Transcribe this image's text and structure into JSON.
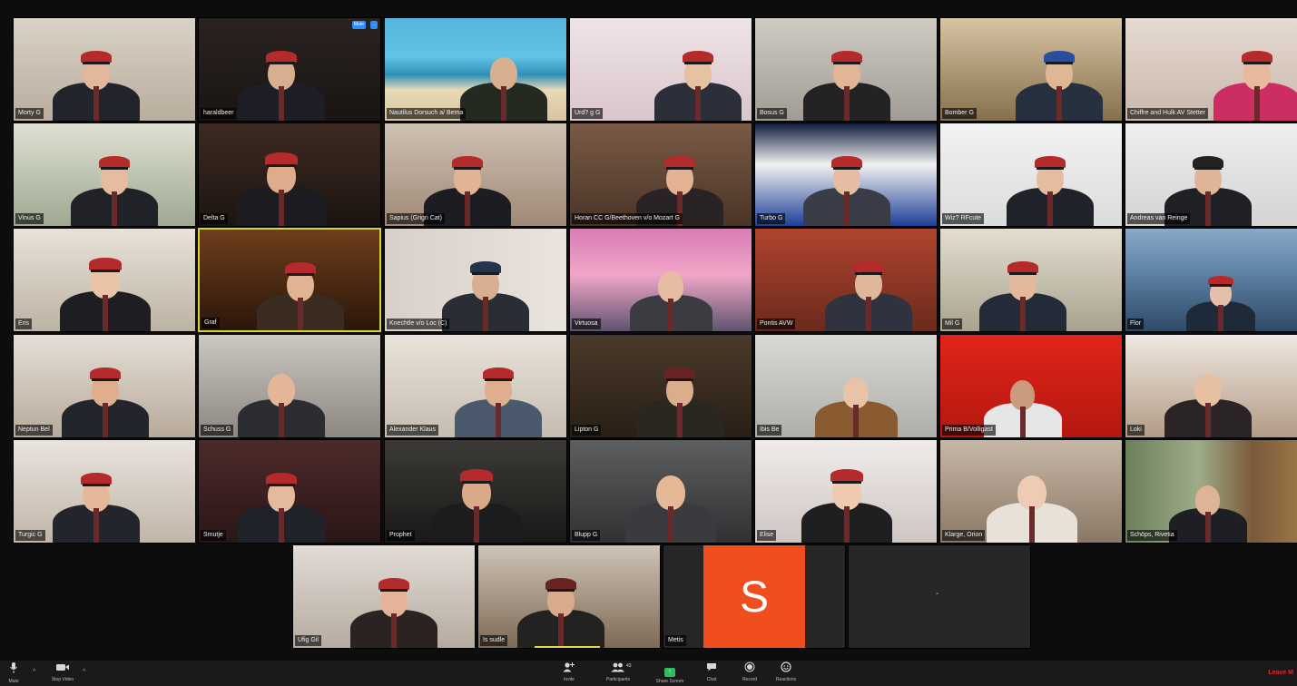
{
  "gallery": {
    "row1": [
      {
        "name": "Morty G"
      },
      {
        "name": "haraldbeer"
      },
      {
        "name": "Nautilus Dorsuch a/ Bema"
      },
      {
        "name": "Urd? g G"
      },
      {
        "name": "Bosus G"
      },
      {
        "name": "Bomber G"
      },
      {
        "name": "Chiffre and Hulk AV Stetter"
      }
    ],
    "row2": [
      {
        "name": "Vinus G"
      },
      {
        "name": "Delta G"
      },
      {
        "name": "Sapius (Grigri Cat)"
      },
      {
        "name": "Horan CC G/Beethoven v/o Mozart G"
      },
      {
        "name": "Turbo G"
      },
      {
        "name": "Wiz? RFcute"
      },
      {
        "name": "Andreas van Reinge"
      }
    ],
    "row3": [
      {
        "name": "Eris"
      },
      {
        "name": "Graf"
      },
      {
        "name": "Knechtle v/o Loc (C)"
      },
      {
        "name": "Virtuosa"
      },
      {
        "name": "Pontis AVW"
      },
      {
        "name": "Mil G"
      },
      {
        "name": "Flor"
      }
    ],
    "row4": [
      {
        "name": "Neptun Bel"
      },
      {
        "name": "Schuss G"
      },
      {
        "name": "Alexander Klaus"
      },
      {
        "name": "Lipton G"
      },
      {
        "name": "Ibis Be"
      },
      {
        "name": "Prima B/Volligast"
      },
      {
        "name": "Loki"
      }
    ],
    "row5": [
      {
        "name": "Turgic G"
      },
      {
        "name": "Smutje"
      },
      {
        "name": "Prophet"
      },
      {
        "name": "Blupp G"
      },
      {
        "name": "Elise"
      },
      {
        "name": "Klarge, Orion"
      },
      {
        "name": "Schöps, Rivetia"
      }
    ],
    "row6": [
      {
        "name": "Ufig Gil"
      },
      {
        "name": "Is sudle"
      },
      {
        "name": "Metis",
        "initial": "S"
      },
      {
        "name": "",
        "center_text": "-"
      }
    ],
    "tile_controls": {
      "mute_label": "Mute",
      "more_label": "..."
    }
  },
  "toolbar": {
    "mute": "Mute",
    "stop_video": "Stop Video",
    "invite": "Invite",
    "participants": "Participants",
    "participants_count": "43",
    "share_screen": "Share Screen",
    "chat": "Chat",
    "record": "Record",
    "reactions": "Reactions",
    "leave": "Leave M"
  },
  "colors": {
    "cap_red": "#b52a2a",
    "share_green": "#2bbd5e",
    "avatar_orange": "#f04e1e",
    "leave_red": "#e02828",
    "active_speaker": "#d8d23a"
  },
  "icons": {
    "mute": "microphone-icon",
    "video": "video-camera-icon",
    "invite": "add-person-icon",
    "participants": "people-icon",
    "share": "share-screen-icon",
    "chat": "chat-bubble-icon",
    "record": "record-icon",
    "reactions": "emoji-icon"
  }
}
